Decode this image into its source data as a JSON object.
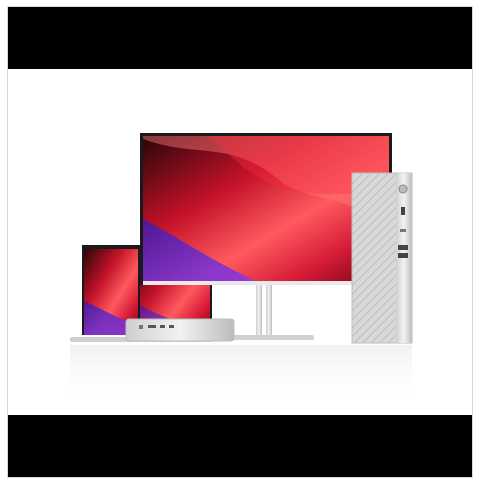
{
  "media": {
    "alt": "",
    "letterbox_color": "#000000",
    "background_color": "#ffffff"
  },
  "products": [
    {
      "name": "laptop-icon"
    },
    {
      "name": "monitor-icon"
    },
    {
      "name": "mini-pc-icon"
    },
    {
      "name": "tower-pc-icon"
    }
  ],
  "colors": {
    "screen_red": "#d0172b",
    "screen_purple": "#5b2ad6",
    "silver": "#d6d6d6",
    "dark_bezel": "#1a1a1a"
  }
}
